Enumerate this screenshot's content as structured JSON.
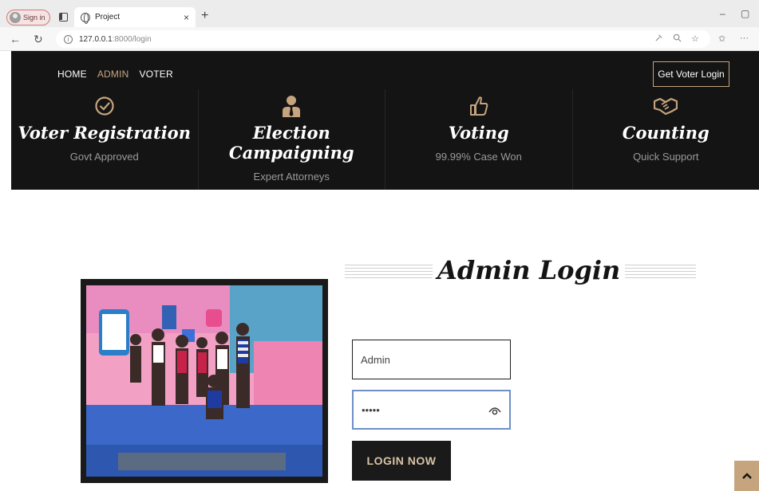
{
  "browser": {
    "signin_label": "Sign in",
    "tab_title": "Project",
    "tab_close": "×",
    "new_tab": "+",
    "url_host": "127.0.0.1",
    "url_rest": ":8000/login",
    "minimize": "–",
    "restore": "▢",
    "more": "···"
  },
  "nav": {
    "home": "HOME",
    "admin": "ADMIN",
    "voter": "VOTER",
    "get_login": "Get Voter Login"
  },
  "features": [
    {
      "icon": "check-circle-icon",
      "title": "Voter Registration",
      "subtitle": "Govt Approved"
    },
    {
      "icon": "user-tie-icon",
      "title": "Election Campaigning",
      "subtitle": "Expert Attorneys"
    },
    {
      "icon": "thumbs-up-icon",
      "title": "Voting",
      "subtitle": "99.99% Case Won"
    },
    {
      "icon": "handshake-icon",
      "title": "Counting",
      "subtitle": "Quick Support"
    }
  ],
  "login": {
    "heading": "Admin Login",
    "username_value": "Admin",
    "password_value": "•••••",
    "button": "LOGIN NOW"
  },
  "colors": {
    "dark": "#141414",
    "accent": "#c5a47e"
  }
}
